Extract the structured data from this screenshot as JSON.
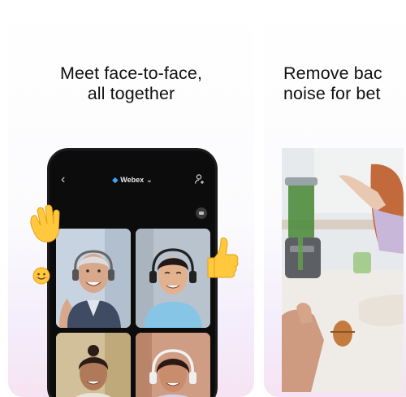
{
  "cards": [
    {
      "headline_line1": "Meet face-to-face,",
      "headline_line2": "all together"
    },
    {
      "headline_line1": "Remove bac",
      "headline_line2": "noise for bet"
    }
  ],
  "phone": {
    "brand_name": "Webex",
    "back_icon": "chevron-left-icon",
    "people_icon": "person-add-icon"
  },
  "emojis": [
    "waving-hand-icon",
    "thumbs-up-icon",
    "smiling-face-icon"
  ],
  "colors": {
    "accent": "#3aa5ff",
    "phone_bg": "#0c0c0c"
  }
}
